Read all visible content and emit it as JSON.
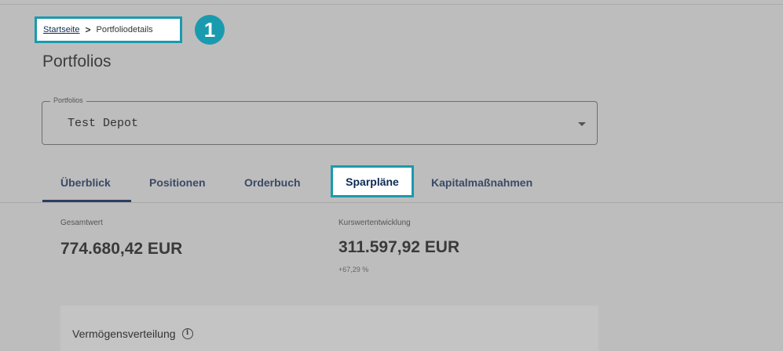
{
  "breadcrumb": {
    "home": "Startseite",
    "separator": ">",
    "current": "Portfoliodetails"
  },
  "step_badge": "1",
  "page_title": "Portfolios",
  "portfolio_select": {
    "label": "Portfolios",
    "value": "Test Depot"
  },
  "tabs": [
    {
      "label": "Überblick",
      "active": true
    },
    {
      "label": "Positionen",
      "active": false
    },
    {
      "label": "Orderbuch",
      "active": false
    },
    {
      "label": "Sparpläne",
      "active": false,
      "highlighted": true
    },
    {
      "label": "Kapitalmaßnahmen",
      "active": false
    }
  ],
  "stats": {
    "total": {
      "label": "Gesamtwert",
      "value": "774.680,42 EUR"
    },
    "performance": {
      "label": "Kurswertentwicklung",
      "value": "311.597,92 EUR",
      "percent": "+67,29 %"
    }
  },
  "allocation_card": {
    "title": "Vermögensverteilung",
    "info_icon": "i"
  },
  "colors": {
    "highlight": "#1a9aae",
    "brand_dark": "#0d2b55",
    "overlay": "#bdbdbd"
  }
}
